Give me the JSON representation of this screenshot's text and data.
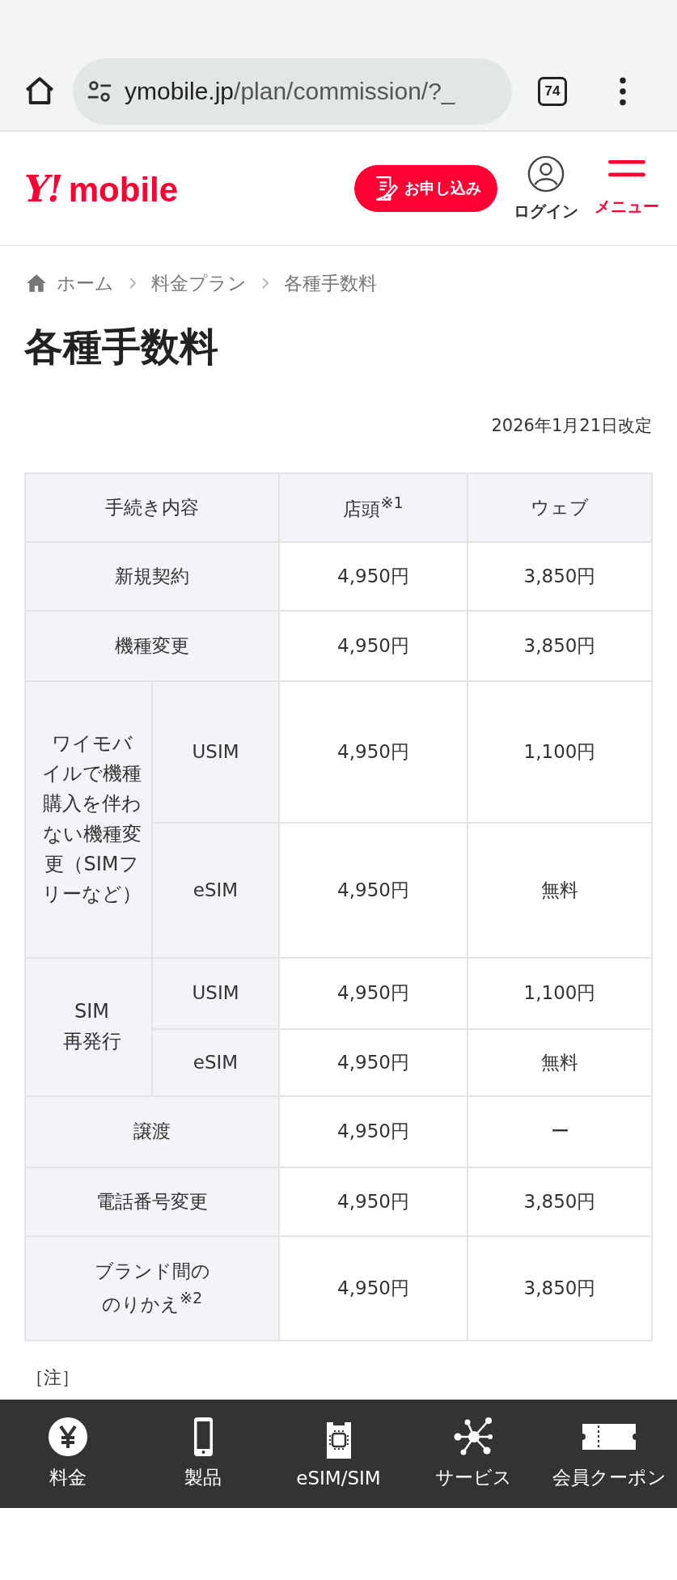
{
  "browser": {
    "url_host": "ymobile.jp",
    "url_path": "/plan/commission/?_",
    "tab_count": "74"
  },
  "header": {
    "logo_mark": "Y!",
    "logo_text": "mobile",
    "apply_button": "お申し込み",
    "login": "ログイン",
    "menu": "メニュー"
  },
  "breadcrumb": [
    {
      "label": "ホーム",
      "kind": "home"
    },
    {
      "label": "料金プラン",
      "kind": "link"
    },
    {
      "label": "各種手数料",
      "kind": "current"
    }
  ],
  "title": "各種手数料",
  "revised_date": "2026年1月21日改定",
  "table": {
    "columns": [
      "手続き内容",
      "店頭$^{※1}$",
      "ウェブ"
    ],
    "rows": [
      {
        "kind": "single",
        "label": "新規契約",
        "shop": "4,950円",
        "web": "3,850円"
      },
      {
        "kind": "single",
        "label": "機種変更",
        "shop": "4,950円",
        "web": "3,850円"
      },
      {
        "kind": "group",
        "label": "ワイモバイルで機種購入を伴わない機種変更（SIMフリーなど）",
        "children": [
          {
            "label": "USIM",
            "shop": "4,950円",
            "web": "1,100円"
          },
          {
            "label": "eSIM",
            "shop": "4,950円",
            "web": "無料"
          }
        ]
      },
      {
        "kind": "group",
        "label": "SIM\n再発行",
        "children": [
          {
            "label": "USIM",
            "shop": "4,950円",
            "web": "1,100円"
          },
          {
            "label": "eSIM",
            "shop": "4,950円",
            "web": "無料"
          }
        ]
      },
      {
        "kind": "single",
        "label": "譲渡",
        "shop": "4,950円",
        "web": "ー"
      },
      {
        "kind": "single",
        "label": "電話番号変更",
        "shop": "4,950円",
        "web": "3,850円"
      },
      {
        "kind": "single",
        "label": "ブランド間ののりかえ$^{※2}$",
        "shop": "4,950円",
        "web": "3,850円"
      }
    ]
  },
  "note": "［注］",
  "bottom_nav": [
    {
      "label": "料金",
      "kind": "yen"
    },
    {
      "label": "製品",
      "kind": "phone"
    },
    {
      "label": "eSIM/SIM",
      "kind": "sim"
    },
    {
      "label": "サービス",
      "kind": "network"
    },
    {
      "label": "会員クーポン",
      "kind": "coupon"
    }
  ]
}
